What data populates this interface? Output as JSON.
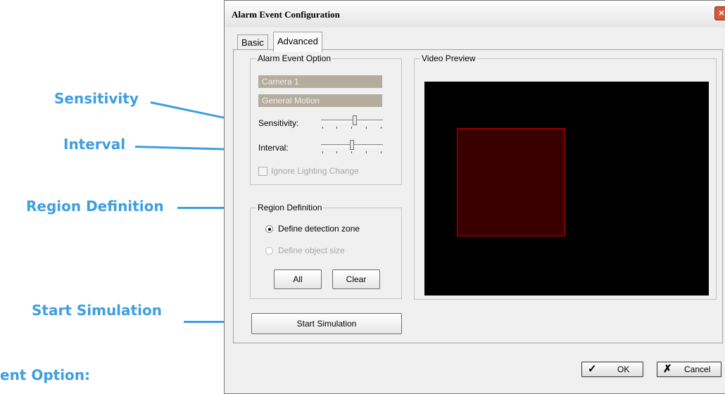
{
  "annotations": {
    "sensitivity": "Sensitivity",
    "interval": "Interval",
    "region_definition": "Region Definition",
    "start_simulation": "Start Simulation",
    "footer_partial": "ent Option:"
  },
  "colors": {
    "annotation": "#3d9fe0",
    "zone_border": "#c00000",
    "video_bg": "#000000"
  },
  "window": {
    "title": "Alarm Event Configuration",
    "close_icon": "close-icon"
  },
  "tabs": {
    "basic": "Basic",
    "advanced": "Advanced"
  },
  "alarm_event_option": {
    "title": "Alarm Event Option",
    "camera": "Camera 1",
    "event": "General Motion",
    "sensitivity_label": "Sensitivity:",
    "sensitivity_level": 0.55,
    "interval_label": "Interval:",
    "interval_level": 0.5,
    "ignore_lighting_label": "Ignore Lighting Change"
  },
  "region_definition": {
    "title": "Region Definition",
    "define_zone": "Define detection zone",
    "define_size": "Define object size",
    "all_button": "All",
    "clear_button": "Clear"
  },
  "start_simulation_button": "Start Simulation",
  "video_preview": {
    "title": "Video Preview"
  },
  "footer": {
    "ok": "OK",
    "cancel": "Cancel"
  }
}
